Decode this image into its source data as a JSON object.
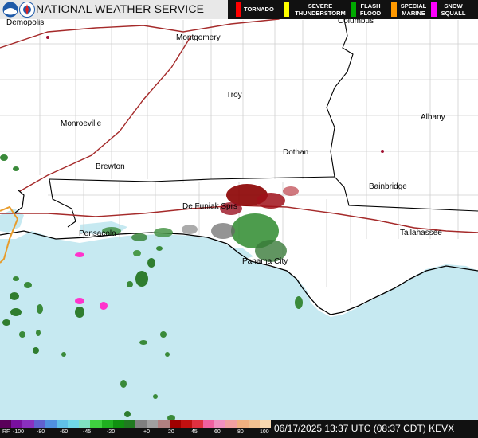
{
  "header": {
    "title": "NATIONAL WEATHER SERVICE",
    "legend": [
      {
        "label": "TORNADO",
        "color": "#ff0000"
      },
      {
        "label": "SEVERE THUNDERSTORM",
        "color": "#ffff00"
      },
      {
        "label": "FLASH FLOOD",
        "color": "#00aa00"
      },
      {
        "label": "SPECIAL MARINE",
        "color": "#ff9900"
      },
      {
        "label": "SNOW SQUALL",
        "color": "#ff00ff"
      }
    ]
  },
  "cities": [
    {
      "name": "Demopolis"
    },
    {
      "name": "Montgomery"
    },
    {
      "name": "Columbus"
    },
    {
      "name": "Troy"
    },
    {
      "name": "Monroeville"
    },
    {
      "name": "Albany"
    },
    {
      "name": "Dothan"
    },
    {
      "name": "Brewton"
    },
    {
      "name": "Bainbridge"
    },
    {
      "name": "De Funiak Sprs"
    },
    {
      "name": "Pensacola"
    },
    {
      "name": "Tallahassee"
    },
    {
      "name": "Panama City"
    }
  ],
  "colors": {
    "land": "#ffffff",
    "water": "#c6e9f1",
    "county_lines": "#d0d0d0",
    "state_lines": "#000000",
    "highways": "#a52a2a",
    "warning_box": "#e89b2a"
  },
  "footer": {
    "scale_units": "RF",
    "scale_labels": [
      "RF",
      "-100",
      "-80",
      "-60",
      "-45",
      "-20",
      "+0",
      "20",
      "45",
      "60",
      "80",
      "100"
    ],
    "timestamp": "06/17/2025 13:37 UTC (08:37 CDT) KEVX"
  }
}
